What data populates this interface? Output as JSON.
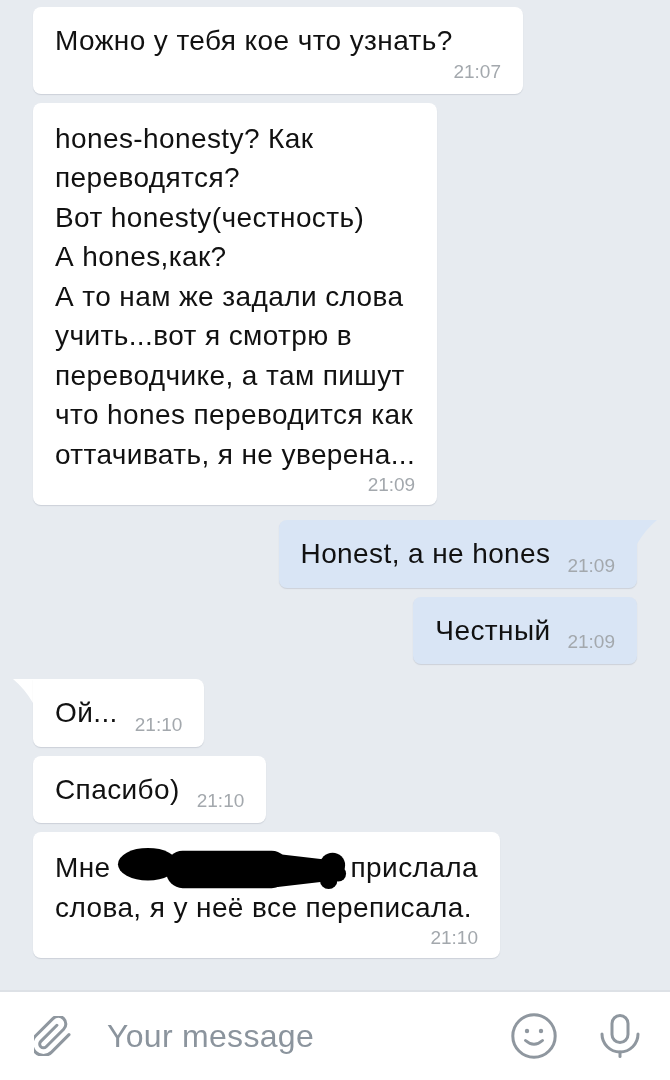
{
  "messages": [
    {
      "kind": "incoming",
      "tail": false,
      "text": "Можно у тебя кое что узнать?",
      "time": "21:07"
    },
    {
      "kind": "incoming",
      "tail": false,
      "text": "hones-honesty? Как\nпереводятся?\nВот honesty(честность)\nА hones,как?\nА то нам же задали слова\nучить...вот я смотрю в\nпереводчике, а там пишут\nчто hones переводится как\nоттачивать, я не уверена...",
      "time": "21:09"
    },
    {
      "kind": "outgoing",
      "tail": true,
      "text": "Honest, а не hones",
      "time": "21:09"
    },
    {
      "kind": "outgoing",
      "tail": false,
      "text": "Честный",
      "time": "21:09"
    },
    {
      "kind": "incoming",
      "tail": true,
      "text": "Ой...",
      "time": "21:10"
    },
    {
      "kind": "incoming",
      "tail": false,
      "text": "Спасибо)",
      "time": "21:10"
    },
    {
      "kind": "incoming",
      "tail": false,
      "lines": [
        [
          {
            "kind": "text",
            "text": "Мне"
          },
          {
            "kind": "redaction"
          },
          {
            "kind": "text",
            "text": "прислала"
          }
        ],
        [
          {
            "kind": "text",
            "text": "слова, я у неё все переписала."
          }
        ]
      ],
      "time": "21:10"
    }
  ],
  "composer": {
    "placeholder": "Your message"
  }
}
